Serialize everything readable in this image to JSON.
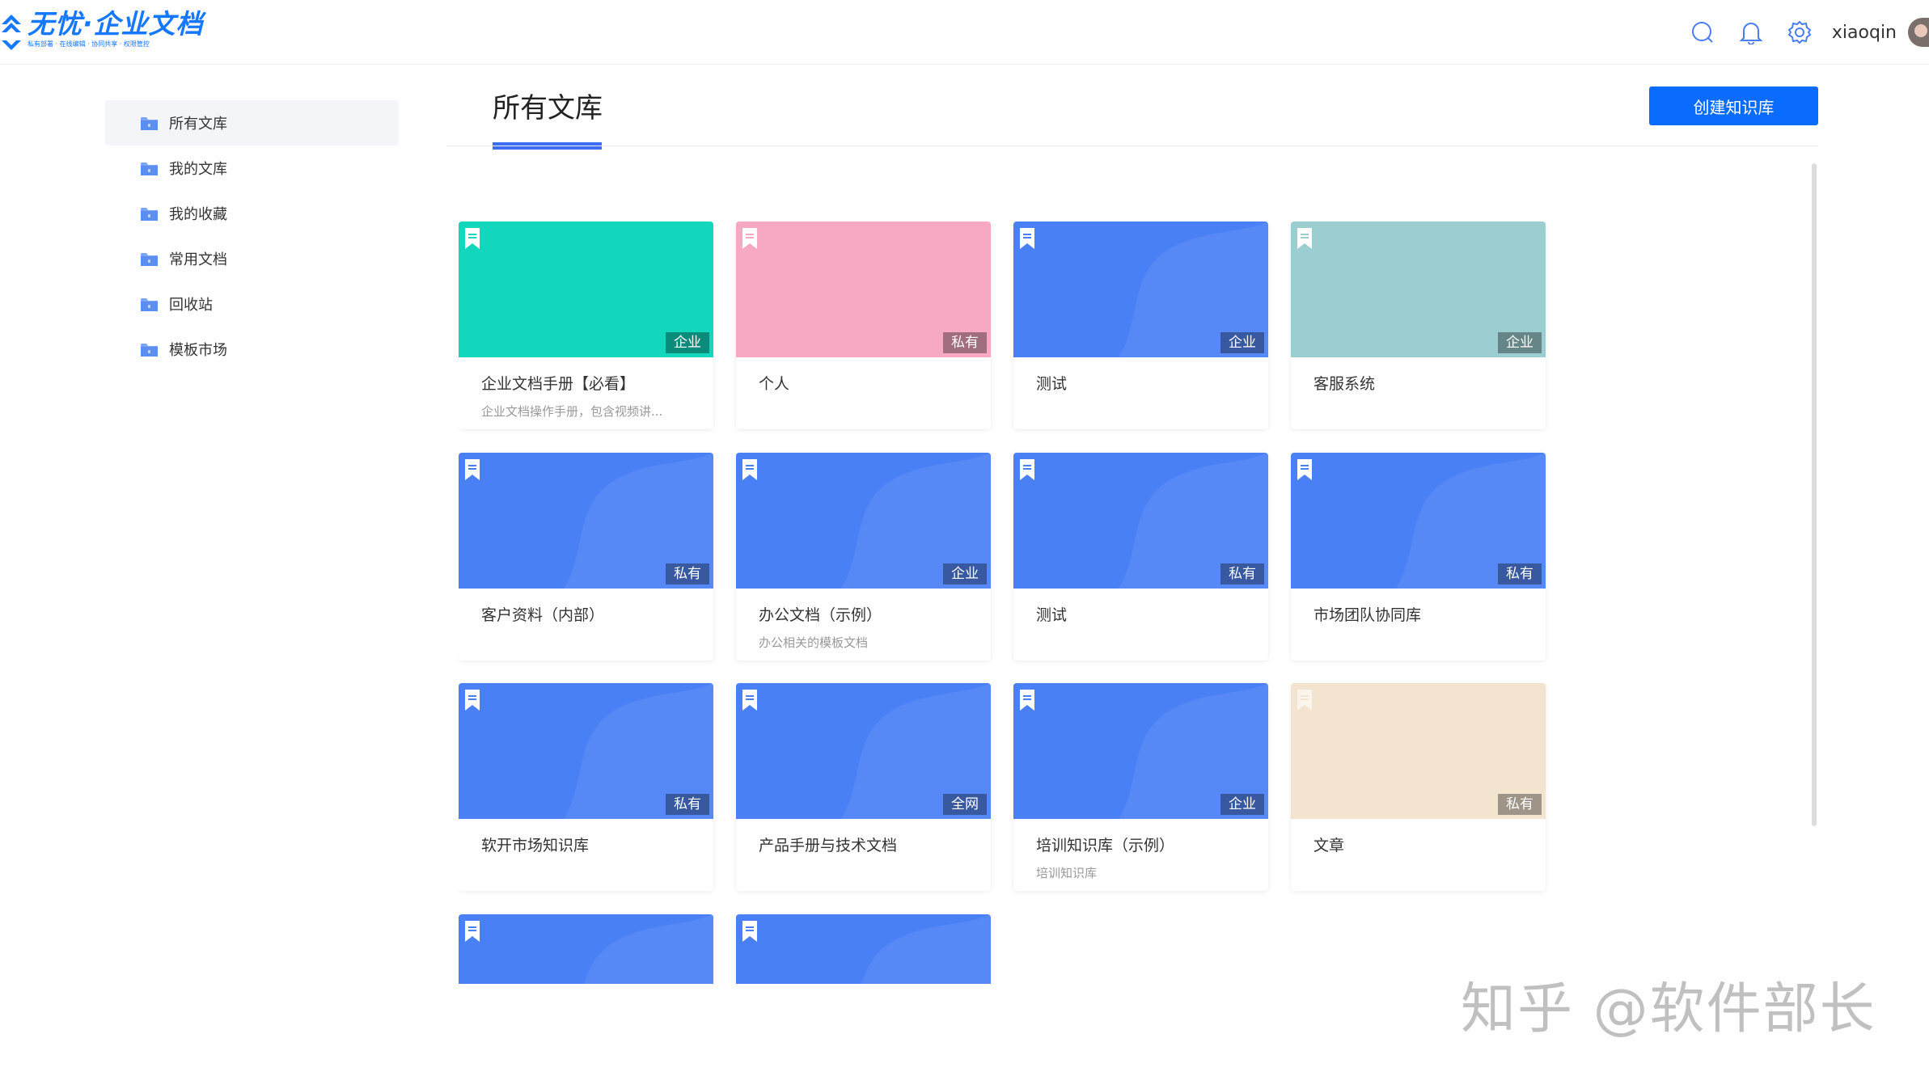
{
  "app": {
    "logo_title": "无忧·企业文档",
    "logo_subtitle": "私有部署 · 在线编辑 · 协同共享 · 权限管控"
  },
  "header": {
    "icons": [
      "search-icon",
      "bell-icon",
      "gear-icon"
    ],
    "username": "xiaoqin"
  },
  "sidebar": {
    "items": [
      {
        "label": "所有文库",
        "active": true
      },
      {
        "label": "我的文库",
        "active": false
      },
      {
        "label": "我的收藏",
        "active": false
      },
      {
        "label": "常用文档",
        "active": false
      },
      {
        "label": "回收站",
        "active": false
      },
      {
        "label": "模板市场",
        "active": false
      }
    ]
  },
  "main": {
    "title": "所有文库",
    "create_button": "创建知识库"
  },
  "colors": {
    "accent": "#0a6cff",
    "blue_cover": "#4a80f5",
    "teal_cover": "#12d7bd",
    "pink_cover": "#f7a9c4",
    "grayteal_cover": "#9ccdd0",
    "beige_cover": "#f3e4cf"
  },
  "libraries": [
    {
      "name": "企业文档手册【必看】",
      "desc": "企业文档操作手册，包含视频讲...",
      "badge": "企业",
      "cover": "teal"
    },
    {
      "name": "个人",
      "desc": "",
      "badge": "私有",
      "cover": "pink"
    },
    {
      "name": "测试",
      "desc": "",
      "badge": "企业",
      "cover": "blue"
    },
    {
      "name": "客服系统",
      "desc": "",
      "badge": "企业",
      "cover": "grayteal"
    },
    {
      "name": "客户资料（内部）",
      "desc": "",
      "badge": "私有",
      "cover": "blue"
    },
    {
      "name": "办公文档（示例）",
      "desc": "办公相关的模板文档",
      "badge": "企业",
      "cover": "blue"
    },
    {
      "name": "测试",
      "desc": "",
      "badge": "私有",
      "cover": "blue"
    },
    {
      "name": "市场团队协同库",
      "desc": "",
      "badge": "私有",
      "cover": "blue"
    },
    {
      "name": "软开市场知识库",
      "desc": "",
      "badge": "私有",
      "cover": "blue"
    },
    {
      "name": "产品手册与技术文档",
      "desc": "",
      "badge": "全网",
      "cover": "blue"
    },
    {
      "name": "培训知识库（示例）",
      "desc": "培训知识库",
      "badge": "企业",
      "cover": "blue"
    },
    {
      "name": "文章",
      "desc": "",
      "badge": "私有",
      "cover": "beige"
    },
    {
      "name": "",
      "desc": "",
      "badge": "",
      "cover": "blue"
    },
    {
      "name": "",
      "desc": "",
      "badge": "",
      "cover": "blue"
    }
  ],
  "watermark": "知乎 @软件部长"
}
